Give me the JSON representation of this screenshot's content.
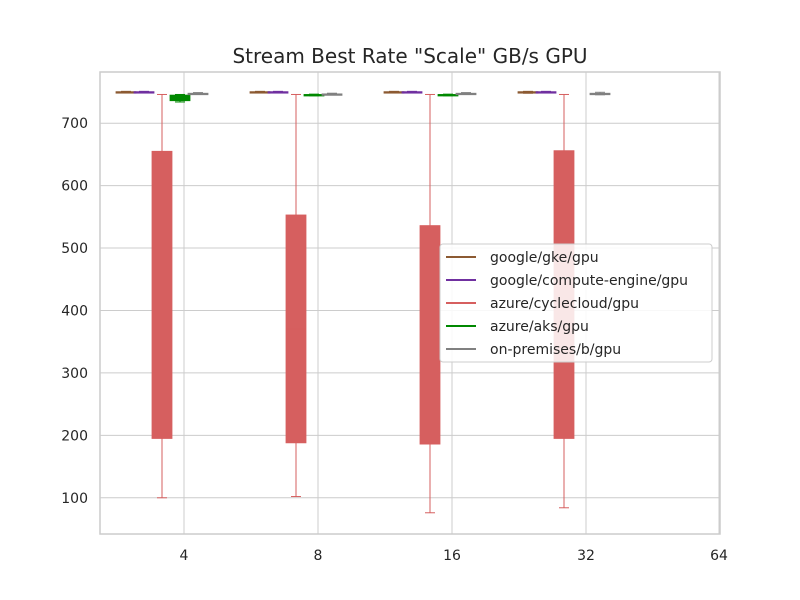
{
  "chart_data": {
    "type": "box",
    "title": "Stream Best Rate \"Scale\" GB/s GPU",
    "xlabel": "",
    "ylabel": "",
    "categories": [
      "4",
      "8",
      "16",
      "32",
      "64"
    ],
    "ylim": [
      42,
      782
    ],
    "yticks": [
      100,
      200,
      300,
      400,
      500,
      600,
      700
    ],
    "grid": true,
    "legend": {
      "placement": "center-right",
      "entries": [
        "google/gke/gpu",
        "google/compute-engine/gpu",
        "azure/cyclecloud/gpu",
        "azure/aks/gpu",
        "on-premises/b/gpu"
      ]
    },
    "series": [
      {
        "name": "google/gke/gpu",
        "color": "#8c5a32",
        "boxes": [
          {
            "category": "4",
            "whislo": 749,
            "q1": 749.5,
            "med": 750,
            "q3": 750.5,
            "whishi": 751
          },
          {
            "category": "8",
            "whislo": 749,
            "q1": 749.5,
            "med": 750,
            "q3": 750.5,
            "whishi": 751
          },
          {
            "category": "16",
            "whislo": 749,
            "q1": 749.5,
            "med": 750,
            "q3": 750.5,
            "whishi": 751
          },
          {
            "category": "32",
            "whislo": 748,
            "q1": 749,
            "med": 750,
            "q3": 750.5,
            "whishi": 751
          }
        ]
      },
      {
        "name": "google/compute-engine/gpu",
        "color": "#7030a0",
        "boxes": [
          {
            "category": "4",
            "whislo": 749,
            "q1": 749.5,
            "med": 750,
            "q3": 750.5,
            "whishi": 751
          },
          {
            "category": "8",
            "whislo": 749,
            "q1": 749.5,
            "med": 750,
            "q3": 750.5,
            "whishi": 751
          },
          {
            "category": "16",
            "whislo": 749,
            "q1": 749.5,
            "med": 750,
            "q3": 750.5,
            "whishi": 751
          },
          {
            "category": "32",
            "whislo": 749,
            "q1": 749.5,
            "med": 750,
            "q3": 750.5,
            "whishi": 751
          }
        ]
      },
      {
        "name": "azure/cyclecloud/gpu",
        "color": "#d65f5f",
        "boxes": [
          {
            "category": "4",
            "whislo": 100,
            "q1": 195,
            "med": 420,
            "q3": 655,
            "whishi": 746
          },
          {
            "category": "8",
            "whislo": 102,
            "q1": 188,
            "med": 370,
            "q3": 553,
            "whishi": 746
          },
          {
            "category": "16",
            "whislo": 76,
            "q1": 186,
            "med": 360,
            "q3": 536,
            "whishi": 746
          },
          {
            "category": "32",
            "whislo": 84,
            "q1": 195,
            "med": 425,
            "q3": 656,
            "whishi": 746
          }
        ]
      },
      {
        "name": "azure/aks/gpu",
        "color": "#008800",
        "boxes": [
          {
            "category": "4",
            "whislo": 734,
            "q1": 736,
            "med": 742,
            "q3": 745,
            "whishi": 746
          },
          {
            "category": "8",
            "whislo": 744,
            "q1": 745,
            "med": 745.5,
            "q3": 746,
            "whishi": 746.5
          },
          {
            "category": "16",
            "whislo": 744,
            "q1": 745,
            "med": 745.5,
            "q3": 746,
            "whishi": 746.5
          }
        ]
      },
      {
        "name": "on-premises/b/gpu",
        "color": "#808080",
        "boxes": [
          {
            "category": "4",
            "whislo": 746.5,
            "q1": 747,
            "med": 747.5,
            "q3": 748,
            "whishi": 749
          },
          {
            "category": "8",
            "whislo": 745.5,
            "q1": 746,
            "med": 746.5,
            "q3": 747,
            "whishi": 748
          },
          {
            "category": "16",
            "whislo": 746.5,
            "q1": 747,
            "med": 747.5,
            "q3": 748,
            "whishi": 749
          },
          {
            "category": "32",
            "whislo": 745.5,
            "q1": 746,
            "med": 747,
            "q3": 748,
            "whishi": 749.5
          }
        ]
      }
    ]
  }
}
